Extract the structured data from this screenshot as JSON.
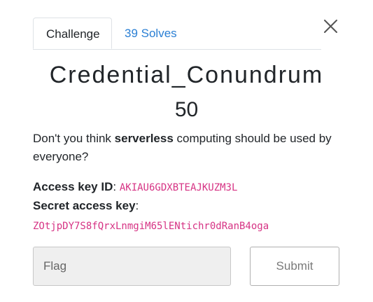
{
  "tabs": {
    "challenge_label": "Challenge",
    "solves_label": "39 Solves"
  },
  "challenge": {
    "name": "Credential_Conundrum",
    "points": "50",
    "description": {
      "part1": "Don't you think ",
      "bold": "serverless",
      "part2": " computing should be used by everyone?"
    },
    "access_key_label": "Access key ID",
    "access_key_value": "AKIAU6GDXBTEAJKUZM3L",
    "secret_key_label": "Secret access key",
    "secret_key_value": "ZOtjpDY7S8fQrxLnmgiM65lENtichr0dRanB4oga",
    "colon": ":"
  },
  "form": {
    "flag_placeholder": "Flag",
    "flag_value": "",
    "submit_label": "Submit"
  },
  "icons": {
    "close": "close-icon"
  },
  "colors": {
    "link": "#2a7fd4",
    "code": "#d63384",
    "text": "#212529"
  }
}
